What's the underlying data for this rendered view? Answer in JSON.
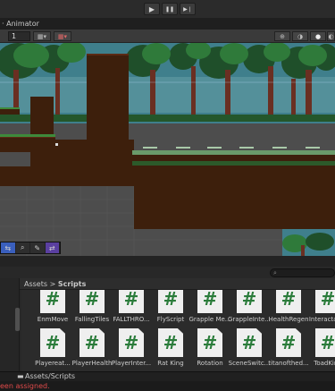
{
  "toolbar": {
    "play_icon": "▶",
    "pause_icon": "❚❚",
    "step_icon": "▶❘"
  },
  "window": {
    "tab_label": "Animator"
  },
  "scene_toolbar": {
    "field_value": "1"
  },
  "project": {
    "breadcrumb": {
      "root": "Assets",
      "separator": ">",
      "current": "Scripts"
    },
    "search_placeholder": "",
    "path": "Assets/Scripts",
    "row1": [
      "EnmMove",
      "FallingTiles",
      "FALLTHRO...",
      "FlyScript",
      "Grapple Me...",
      "GrappleInte...",
      "HealthRegen",
      "Interactable"
    ],
    "row2": [
      "Playereat...",
      "PlayerHealth",
      "PlayerInter...",
      "Rat King",
      "Rotation",
      "SceneSwitc...",
      "titanofthed...",
      "ToadKing"
    ],
    "icon_glyph": "#"
  },
  "status": {
    "message": "een assigned."
  },
  "colors": {
    "script_icon_green": "#2b7c3b",
    "error_red": "#e04a4a",
    "sky": "#3f7f8c"
  }
}
